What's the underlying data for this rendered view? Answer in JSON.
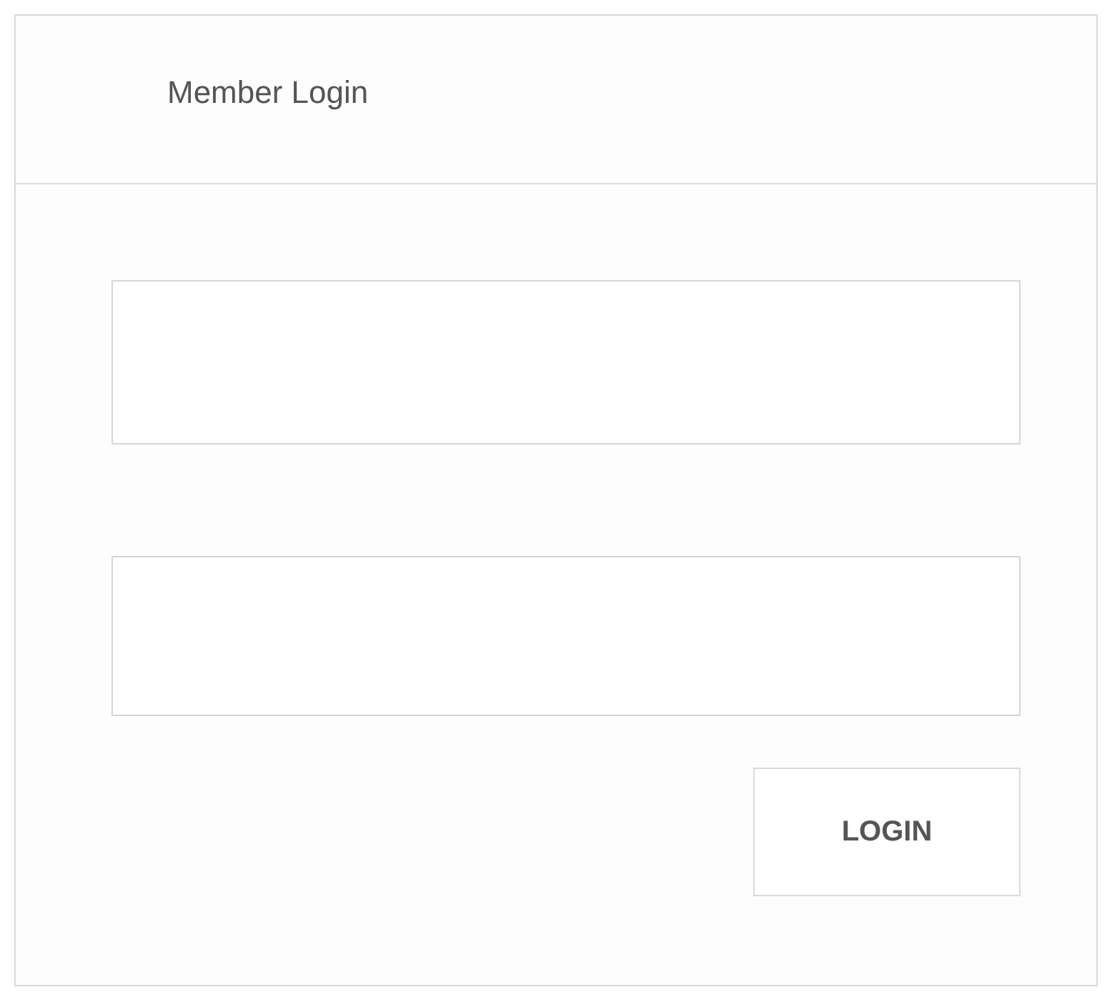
{
  "title": "Member Login",
  "button": "LOGIN"
}
